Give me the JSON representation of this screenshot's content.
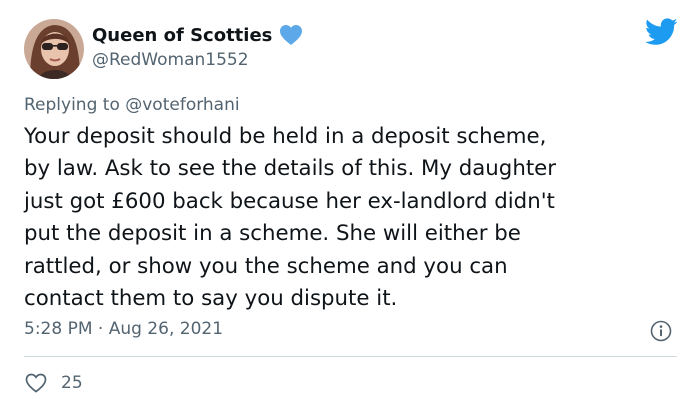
{
  "author": {
    "display_name": "Queen of Scotties",
    "handle": "@RedWoman1552",
    "badge_icon": "blue-heart-icon",
    "avatar_icon": "profile-photo"
  },
  "platform": {
    "logo_icon": "twitter-bird-icon",
    "brand_color": "#1d9bf0"
  },
  "reply": {
    "prefix": "Replying to",
    "mention": "@voteforhani"
  },
  "tweet": {
    "text": "Your deposit should be held in a deposit scheme,\nby law. Ask to see the details of this. My daughter\njust got £600 back because her ex-landlord didn't\nput the deposit in a scheme. She will either be\nrattled, or show you the scheme and you can\ncontact them to say you dispute it.",
    "timestamp": "5:28 PM · Aug 26, 2021",
    "info_icon": "info-icon"
  },
  "engagement": {
    "like_icon": "heart-outline-icon",
    "like_count": "25"
  }
}
